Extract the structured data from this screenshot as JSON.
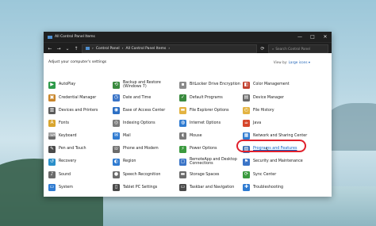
{
  "window": {
    "title": "All Control Panel Items",
    "controls": {
      "minimize": "—",
      "maximize": "□",
      "close": "✕"
    }
  },
  "navbar": {
    "back": "←",
    "forward": "→",
    "recent": "⌄",
    "up": "↑",
    "breadcrumb": [
      "›",
      "Control Panel",
      "›",
      "All Control Panel Items",
      "›"
    ],
    "refresh": "⟳",
    "search_placeholder": "Search Control Panel"
  },
  "content": {
    "heading": "Adjust your computer's settings",
    "view_by_label": "View by:",
    "view_by_value": "Large icons ▾"
  },
  "items": [
    {
      "label": "AutoPlay",
      "icon": "autoplay-icon",
      "color": "#2e9a4a",
      "glyph": "▶"
    },
    {
      "label": "Backup and Restore (Windows 7)",
      "icon": "backup-icon",
      "color": "#3a8a3e",
      "glyph": "⟲"
    },
    {
      "label": "BitLocker Drive Encryption",
      "icon": "bitlocker-icon",
      "color": "#8a8a8a",
      "glyph": "▪"
    },
    {
      "label": "Color Management",
      "icon": "color-management-icon",
      "color": "#c2412f",
      "glyph": "◧"
    },
    {
      "label": "Credential Manager",
      "icon": "credential-manager-icon",
      "color": "#c9862b",
      "glyph": "▣"
    },
    {
      "label": "Date and Time",
      "icon": "date-time-icon",
      "color": "#3a74c7",
      "glyph": "◷"
    },
    {
      "label": "Default Programs",
      "icon": "default-programs-icon",
      "color": "#3a8a3e",
      "glyph": "✓"
    },
    {
      "label": "Device Manager",
      "icon": "device-manager-icon",
      "color": "#6a6a6a",
      "glyph": "▤"
    },
    {
      "label": "Devices and Printers",
      "icon": "printer-icon",
      "color": "#5a5a5a",
      "glyph": "▥"
    },
    {
      "label": "Ease of Access Center",
      "icon": "ease-of-access-icon",
      "color": "#2c6fc4",
      "glyph": "◉"
    },
    {
      "label": "File Explorer Options",
      "icon": "folder-options-icon",
      "color": "#e3b341",
      "glyph": "▬"
    },
    {
      "label": "File History",
      "icon": "file-history-icon",
      "color": "#e3b341",
      "glyph": "◴"
    },
    {
      "label": "Fonts",
      "icon": "fonts-icon",
      "color": "#d9a52e",
      "glyph": "A"
    },
    {
      "label": "Indexing Options",
      "icon": "indexing-icon",
      "color": "#7a7a7a",
      "glyph": "◎"
    },
    {
      "label": "Internet Options",
      "icon": "internet-options-icon",
      "color": "#2f7bd1",
      "glyph": "◍"
    },
    {
      "label": "Java",
      "icon": "java-icon",
      "color": "#d6452a",
      "glyph": "☕"
    },
    {
      "label": "Keyboard",
      "icon": "keyboard-icon",
      "color": "#6b6b6b",
      "glyph": "⌨"
    },
    {
      "label": "Mail",
      "icon": "mail-icon",
      "color": "#2f7bd1",
      "glyph": "✉"
    },
    {
      "label": "Mouse",
      "icon": "mouse-icon",
      "color": "#7a7a7a",
      "glyph": "◖"
    },
    {
      "label": "Network and Sharing Center",
      "icon": "network-icon",
      "color": "#2f7bd1",
      "glyph": "▦"
    },
    {
      "label": "Pen and Touch",
      "icon": "pen-touch-icon",
      "color": "#4a4a4a",
      "glyph": "✎"
    },
    {
      "label": "Phone and Modem",
      "icon": "phone-modem-icon",
      "color": "#6b6b6b",
      "glyph": "☏"
    },
    {
      "label": "Power Options",
      "icon": "power-options-icon",
      "color": "#3a9a3e",
      "glyph": "⚡"
    },
    {
      "label": "Programs and Features",
      "icon": "programs-features-icon",
      "color": "#3c6fb3",
      "glyph": "▧",
      "highlighted": true
    },
    {
      "label": "Recovery",
      "icon": "recovery-icon",
      "color": "#2a8fc9",
      "glyph": "↺"
    },
    {
      "label": "Region",
      "icon": "region-icon",
      "color": "#2f7bd1",
      "glyph": "◐"
    },
    {
      "label": "RemoteApp and Desktop Connections",
      "icon": "remoteapp-icon",
      "color": "#3a74c7",
      "glyph": "▢"
    },
    {
      "label": "Security and Maintenance",
      "icon": "security-maintenance-icon",
      "color": "#3a74c7",
      "glyph": "⚑"
    },
    {
      "label": "Sound",
      "icon": "sound-icon",
      "color": "#6b6b6b",
      "glyph": "♪"
    },
    {
      "label": "Speech Recognition",
      "icon": "speech-recognition-icon",
      "color": "#6b6b6b",
      "glyph": "●"
    },
    {
      "label": "Storage Spaces",
      "icon": "storage-spaces-icon",
      "color": "#6b6b6b",
      "glyph": "▬"
    },
    {
      "label": "Sync Center",
      "icon": "sync-center-icon",
      "color": "#3a9a3e",
      "glyph": "⟳"
    },
    {
      "label": "System",
      "icon": "system-icon",
      "color": "#2f7bd1",
      "glyph": "▭"
    },
    {
      "label": "Tablet PC Settings",
      "icon": "tablet-pc-icon",
      "color": "#4a4a4a",
      "glyph": "▯"
    },
    {
      "label": "Taskbar and Navigation",
      "icon": "taskbar-icon",
      "color": "#4a4a4a",
      "glyph": "▭"
    },
    {
      "label": "Troubleshooting",
      "icon": "troubleshooting-icon",
      "color": "#2f7bd1",
      "glyph": "✚"
    }
  ]
}
